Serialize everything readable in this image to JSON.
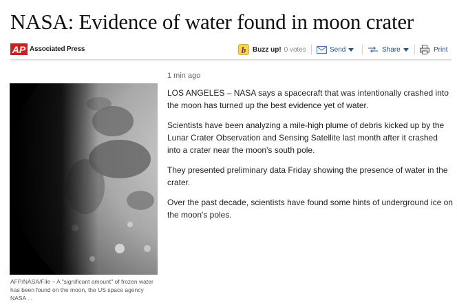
{
  "article": {
    "headline": "NASA: Evidence of water found in moon crater",
    "source": "Associated Press",
    "timestamp": "1 min ago",
    "paragraphs": [
      "LOS ANGELES – NASA says a spacecraft that was intentionally crashed into the moon has turned up the best evidence yet of water.",
      "Scientists have been analyzing a mile-high plume of debris kicked up by the Lunar Crater Observation and Sensing Satellite last month after it crashed into a crater near the moon's south pole.",
      "They presented preliminary data Friday showing the presence of water in the crater.",
      "Over the past decade, scientists have found some hints of underground ice on the moon's poles."
    ],
    "photo": {
      "caption": "AFP/NASA/File – A \"significant amount\" of frozen water has been found on the moon, the US space agency NASA ..."
    }
  },
  "toolbar": {
    "buzz_label": "Buzz up!",
    "buzz_votes": "0 votes",
    "send_label": "Send",
    "share_label": "Share",
    "print_label": "Print"
  },
  "icons": [
    "ap-logo",
    "buzz-icon",
    "envelope-icon",
    "share-icon",
    "printer-icon"
  ],
  "colors": {
    "ap_red": "#cc1f1f",
    "link_blue": "#1d4f8c",
    "buzz_yellow": "#f4d93f"
  }
}
